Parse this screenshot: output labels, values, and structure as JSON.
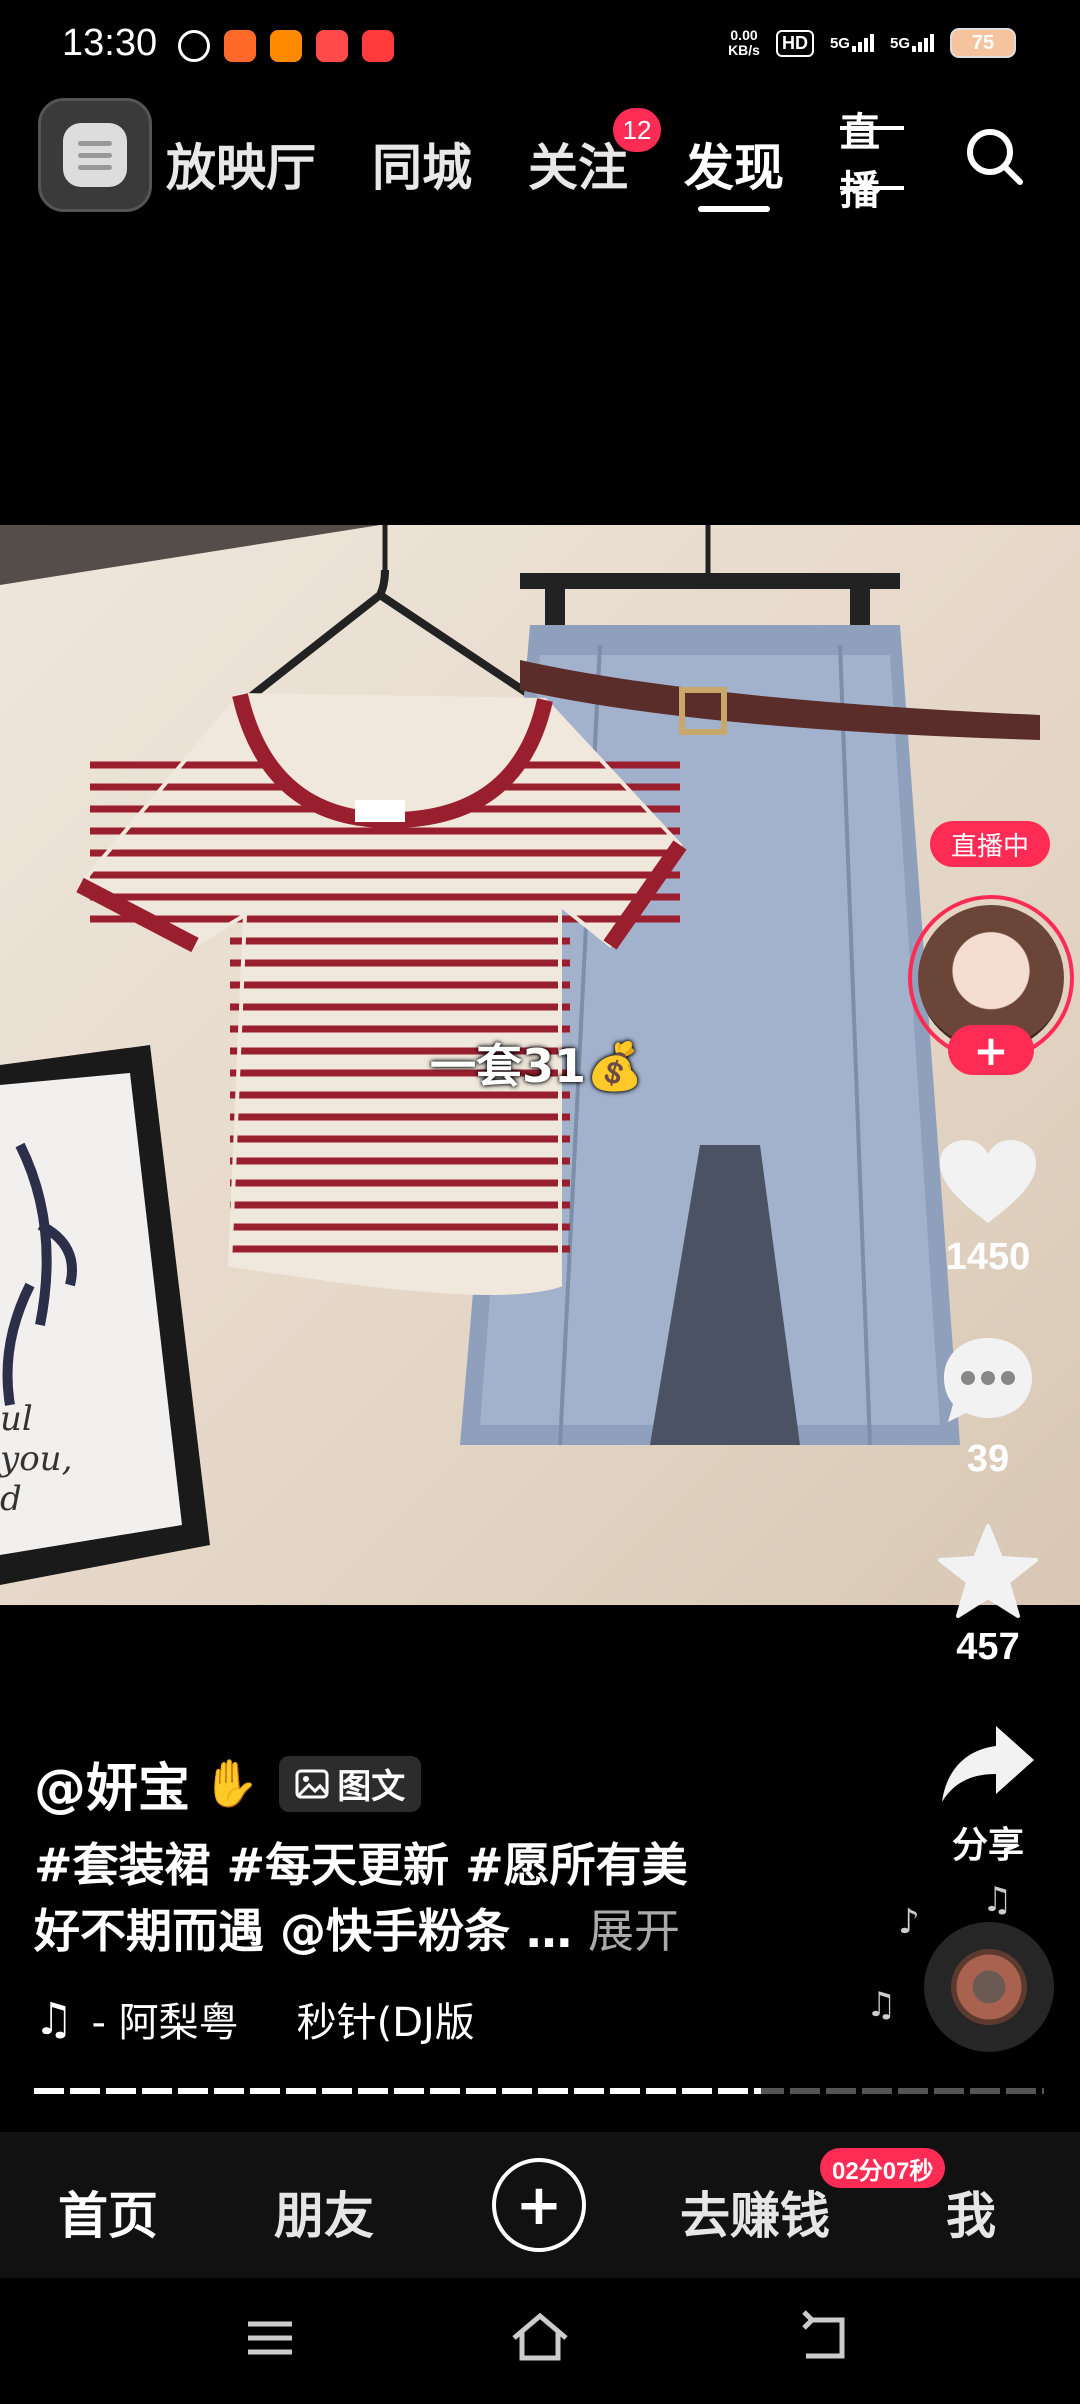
{
  "status_bar": {
    "time": "13:30",
    "net_speed_value": "0.00",
    "net_speed_unit": "KB/s",
    "hd_label": "HD",
    "signal_1": "5G",
    "signal_2": "5G",
    "battery": "75"
  },
  "top_nav": {
    "tabs": [
      "放映厅",
      "同城",
      "关注",
      "发现"
    ],
    "follow_badge": "12",
    "live_label": "直播",
    "active_tab": "发现"
  },
  "post": {
    "overlay_caption": "一套31💰",
    "live_tag": "直播中",
    "follow_plus": "+",
    "likes": "1450",
    "comments": "39",
    "favorites": "457",
    "share_label": "分享",
    "author": "@妍宝",
    "type_badge": "图文",
    "caption_line1": "#套装裙 #每天更新 #愿所有美",
    "caption_line2": "好不期而遇 @快手粉条 …",
    "expand_label": "展开",
    "music_artist": "- 阿梨粤",
    "music_title": "秒针(DJ版",
    "progress_fraction": 0.72
  },
  "tab_bar": {
    "home": "首页",
    "friends": "朋友",
    "plus": "+",
    "earn": "去赚钱",
    "me": "我",
    "timer": "02分07秒"
  },
  "colors": {
    "accent": "#fe2c55",
    "background": "#000000",
    "tab_bar": "#111111"
  },
  "icons": {
    "menu": "menu-icon",
    "search": "search-icon",
    "heart": "heart-icon",
    "comment": "comment-icon",
    "star": "star-icon",
    "share": "share-icon",
    "music": "music-note-icon",
    "sys_menu": "recent-apps-icon",
    "sys_home": "home-icon",
    "sys_back": "back-icon"
  }
}
